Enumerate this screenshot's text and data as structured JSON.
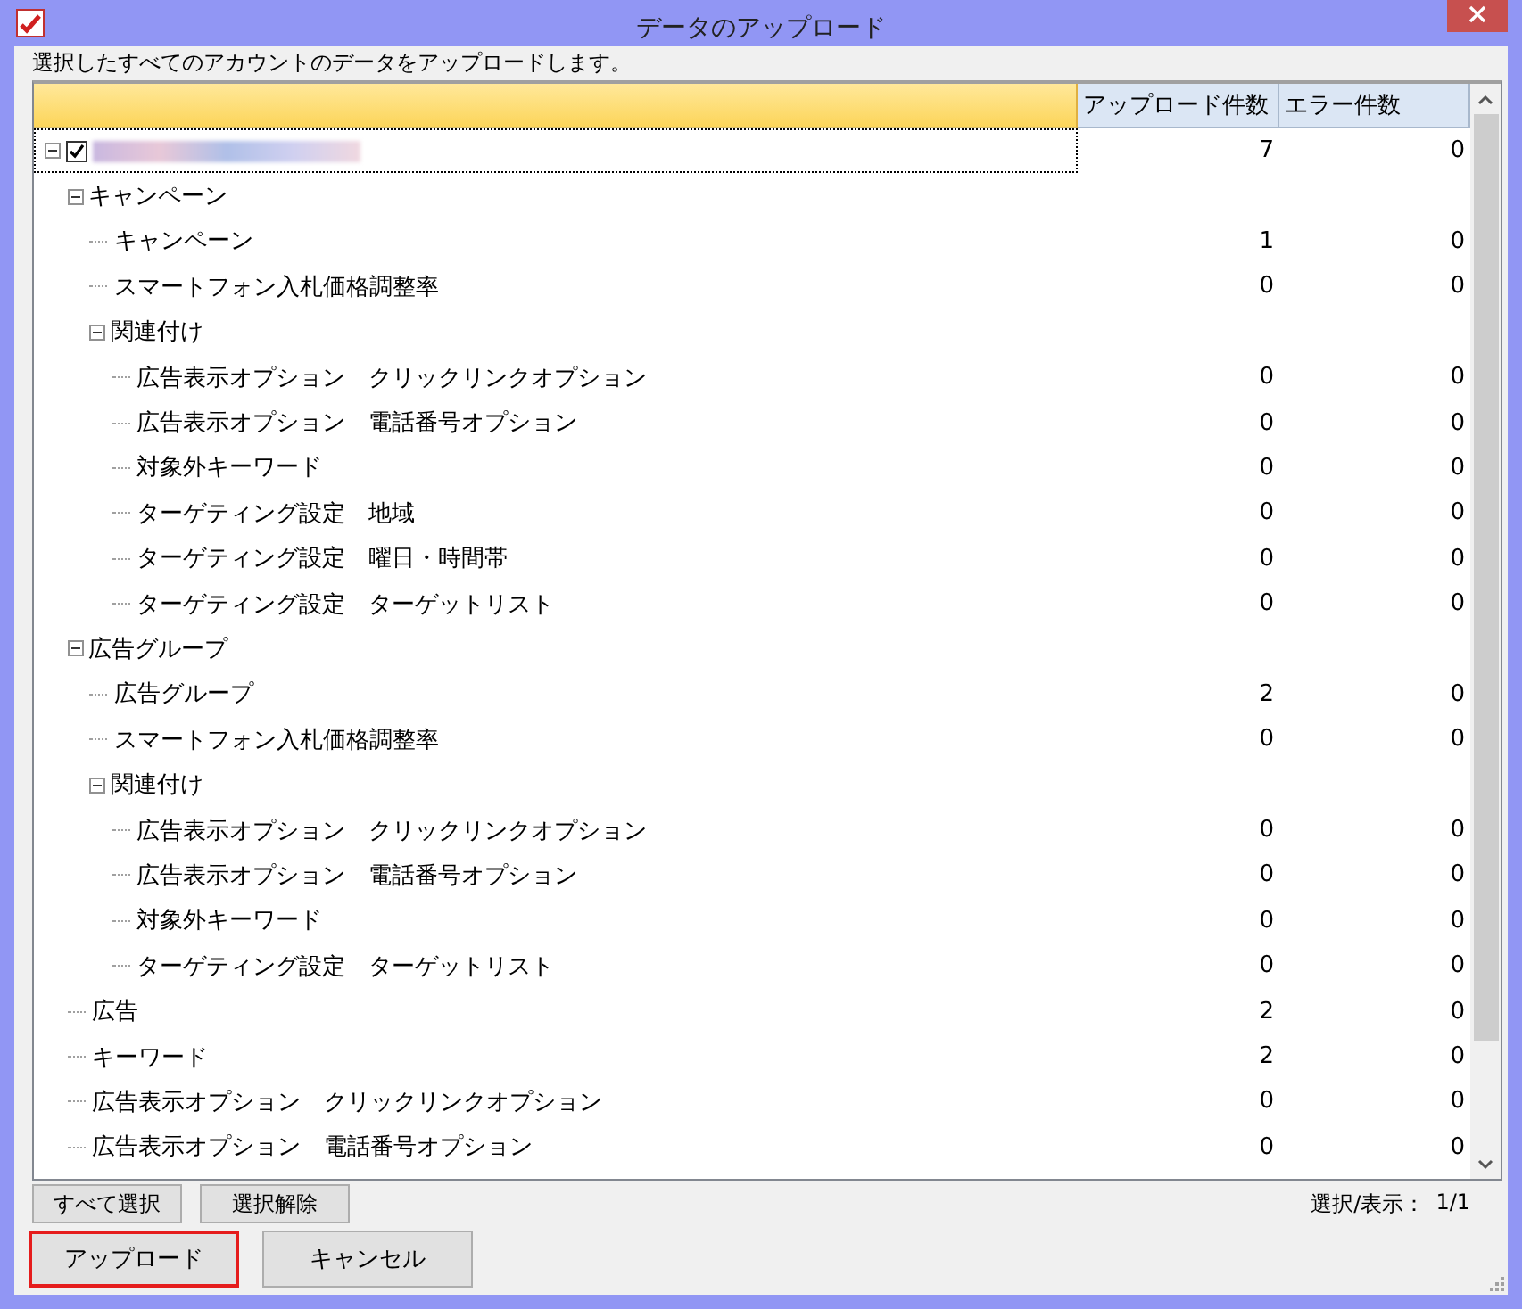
{
  "window": {
    "title": "データのアップロード"
  },
  "instruction": "選択したすべてのアカウントのデータをアップロードします。",
  "table": {
    "columns": [
      "アップロード件数",
      "エラー件数"
    ],
    "root": {
      "checked": true,
      "expanded": true,
      "focused": true,
      "uploads": "7",
      "errors": "0",
      "children": [
        {
          "label": "キャンペーン",
          "expanded": true,
          "children": [
            {
              "label": "キャンペーン",
              "uploads": "1",
              "errors": "0"
            },
            {
              "label": "スマートフォン入札価格調整率",
              "uploads": "0",
              "errors": "0"
            },
            {
              "label": "関連付け",
              "expanded": true,
              "children": [
                {
                  "label": "広告表示オプション　クリックリンクオプション",
                  "uploads": "0",
                  "errors": "0"
                },
                {
                  "label": "広告表示オプション　電話番号オプション",
                  "uploads": "0",
                  "errors": "0"
                },
                {
                  "label": "対象外キーワード",
                  "uploads": "0",
                  "errors": "0"
                },
                {
                  "label": "ターゲティング設定　地域",
                  "uploads": "0",
                  "errors": "0"
                },
                {
                  "label": "ターゲティング設定　曜日・時間帯",
                  "uploads": "0",
                  "errors": "0"
                },
                {
                  "label": "ターゲティング設定　ターゲットリスト",
                  "uploads": "0",
                  "errors": "0"
                }
              ]
            }
          ]
        },
        {
          "label": "広告グループ",
          "expanded": true,
          "children": [
            {
              "label": "広告グループ",
              "uploads": "2",
              "errors": "0"
            },
            {
              "label": "スマートフォン入札価格調整率",
              "uploads": "0",
              "errors": "0"
            },
            {
              "label": "関連付け",
              "expanded": true,
              "children": [
                {
                  "label": "広告表示オプション　クリックリンクオプション",
                  "uploads": "0",
                  "errors": "0"
                },
                {
                  "label": "広告表示オプション　電話番号オプション",
                  "uploads": "0",
                  "errors": "0"
                },
                {
                  "label": "対象外キーワード",
                  "uploads": "0",
                  "errors": "0"
                },
                {
                  "label": "ターゲティング設定　ターゲットリスト",
                  "uploads": "0",
                  "errors": "0"
                }
              ]
            }
          ]
        },
        {
          "label": "広告",
          "uploads": "2",
          "errors": "0"
        },
        {
          "label": "キーワード",
          "uploads": "2",
          "errors": "0"
        },
        {
          "label": "広告表示オプション　クリックリンクオプション",
          "uploads": "0",
          "errors": "0"
        },
        {
          "label": "広告表示オプション　電話番号オプション",
          "uploads": "0",
          "errors": "0"
        }
      ]
    }
  },
  "selection_buttons": [
    "すべて選択",
    "選択解除"
  ],
  "selection_status": {
    "label": "選択/表示：",
    "value": "1/1"
  },
  "buttons": [
    {
      "label": "アップロード",
      "focused": true
    },
    {
      "label": "キャンセル",
      "focused": false
    }
  ]
}
